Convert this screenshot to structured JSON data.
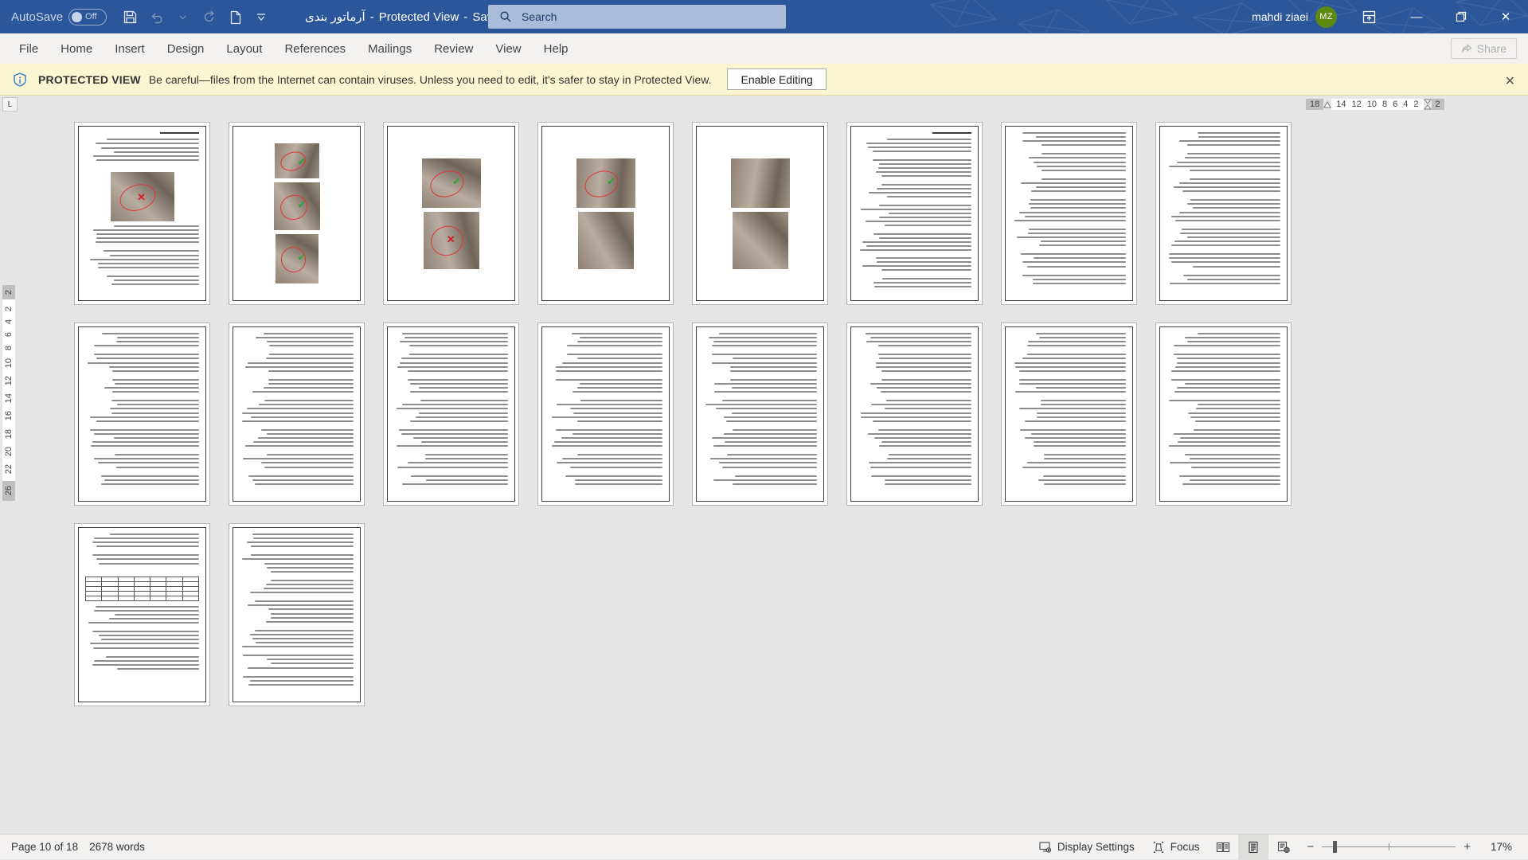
{
  "titlebar": {
    "autosave_label": "AutoSave",
    "autosave_state": "Off",
    "doc_name": "آرماتور بندی",
    "sep1": "-",
    "protected_view": "Protected View",
    "sep2": "-",
    "saved_location": "Saved to this PC",
    "caret": "▾",
    "qat": [
      {
        "name": "save-icon",
        "label": "Save"
      },
      {
        "name": "undo-icon",
        "label": "Undo"
      },
      {
        "name": "undo-dropdown-icon",
        "label": "Undo options"
      },
      {
        "name": "redo-icon",
        "label": "Redo"
      },
      {
        "name": "new-document-icon",
        "label": "New"
      },
      {
        "name": "customize-quick-access-toolbar-icon",
        "label": "Customize Quick Access Toolbar"
      }
    ]
  },
  "search": {
    "placeholder": "Search",
    "icon": "search-icon"
  },
  "account": {
    "name": "mahdi ziaei",
    "initials": "MZ"
  },
  "window": {
    "minimize": "—",
    "restore": "❐",
    "close": "✕",
    "ribbon_display": "ribbon-display-options-icon"
  },
  "ribbon": {
    "tabs": [
      "File",
      "Home",
      "Insert",
      "Design",
      "Layout",
      "References",
      "Mailings",
      "Review",
      "View",
      "Help"
    ],
    "share_label": "Share"
  },
  "protected_view": {
    "title": "PROTECTED VIEW",
    "message": "Be careful—files from the Internet can contain viruses. Unless you need to edit, it's safer to stay in Protected View.",
    "enable_button": "Enable Editing",
    "close": "✕"
  },
  "rulers": {
    "corner_label": "L",
    "horizontal": {
      "left_grey": "18",
      "numbers": [
        "14",
        "12",
        "10",
        "8",
        "6",
        "4",
        "2"
      ],
      "right_grey": "2"
    },
    "vertical": {
      "top_grey": "2",
      "numbers": [
        "2",
        "4",
        "6",
        "8",
        "10",
        "12",
        "14",
        "16",
        "18",
        "20",
        "22"
      ],
      "bottom_grey": "26"
    }
  },
  "statusbar": {
    "page_info": "Page 10 of 18",
    "word_count": "2678 words",
    "display_settings": "Display Settings",
    "focus": "Focus",
    "views": [
      {
        "name": "read-mode-view-icon",
        "active": false
      },
      {
        "name": "print-layout-view-icon",
        "active": true
      },
      {
        "name": "web-layout-view-icon",
        "active": false
      }
    ],
    "zoom_out": "−",
    "zoom_in": "+",
    "zoom_level": "17%"
  },
  "document": {
    "total_pages": 18,
    "pages": [
      {
        "index": 1,
        "layout": "text-photo",
        "has_heading": true,
        "photo_mark": "x"
      },
      {
        "index": 2,
        "layout": "three-photos",
        "photo_marks": [
          "v",
          "v",
          "v"
        ]
      },
      {
        "index": 3,
        "layout": "two-photos",
        "photo_marks": [
          "v",
          "x"
        ]
      },
      {
        "index": 4,
        "layout": "two-photos",
        "photo_marks": [
          "v",
          ""
        ]
      },
      {
        "index": 5,
        "layout": "two-photos",
        "photo_marks": [
          "",
          ""
        ]
      },
      {
        "index": 6,
        "layout": "text",
        "has_heading": true
      },
      {
        "index": 7,
        "layout": "text"
      },
      {
        "index": 8,
        "layout": "text"
      },
      {
        "index": 9,
        "layout": "text"
      },
      {
        "index": 10,
        "layout": "text"
      },
      {
        "index": 11,
        "layout": "text"
      },
      {
        "index": 12,
        "layout": "text"
      },
      {
        "index": 13,
        "layout": "text"
      },
      {
        "index": 14,
        "layout": "text"
      },
      {
        "index": 15,
        "layout": "text"
      },
      {
        "index": 16,
        "layout": "text"
      },
      {
        "index": 17,
        "layout": "text-table"
      },
      {
        "index": 18,
        "layout": "text"
      }
    ]
  }
}
